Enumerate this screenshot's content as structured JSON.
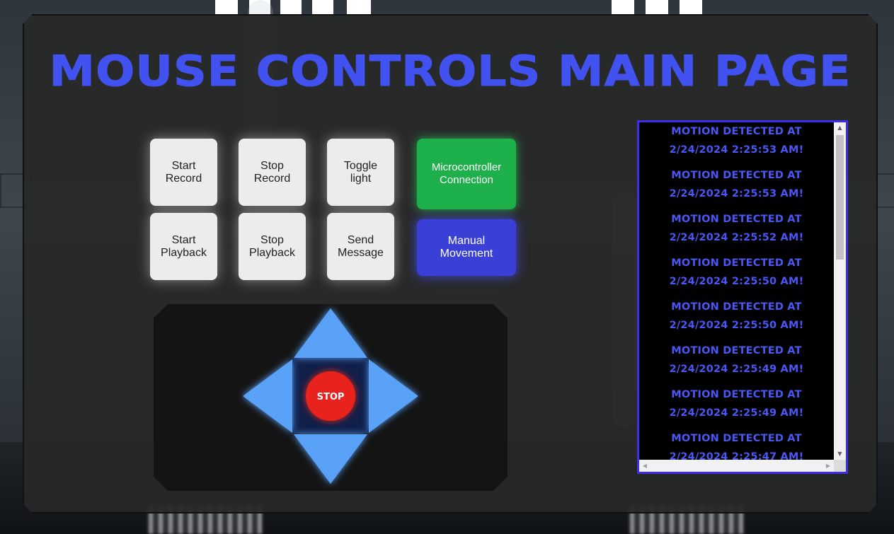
{
  "page": {
    "title": "Mouse Controls Main Page"
  },
  "buttons": {
    "start_record": "Start\nRecord",
    "stop_record": "Stop\nRecord",
    "toggle_light": "Toggle\nlight",
    "start_playback": "Start\nPlayback",
    "stop_playback": "Stop\nPlayback",
    "send_message": "Send\nMessage",
    "microcontroller_connection": "Microcontroller\nConnection",
    "manual_movement": "Manual\nMovement"
  },
  "dpad": {
    "stop_label": "STOP",
    "arrow_color": "#5aa2f8",
    "stop_color": "#e8201c"
  },
  "colors": {
    "title": "#4152f0",
    "connection_button": "#1eb04a",
    "manual_button": "#3a3fd6",
    "log_border": "#3d2fe8"
  },
  "log": {
    "entries": [
      "Motion detected at\n2/24/2024 2:25:53 AM!",
      "Motion detected at\n2/24/2024 2:25:53 AM!",
      "Motion detected at\n2/24/2024 2:25:52 AM!",
      "Motion detected at\n2/24/2024 2:25:50 AM!",
      "Motion detected at\n2/24/2024 2:25:50 AM!",
      "Motion detected at\n2/24/2024 2:25:49 AM!",
      "Motion detected at\n2/24/2024 2:25:49 AM!",
      "Motion detected at\n2/24/2024 2:25:47 AM!"
    ]
  }
}
